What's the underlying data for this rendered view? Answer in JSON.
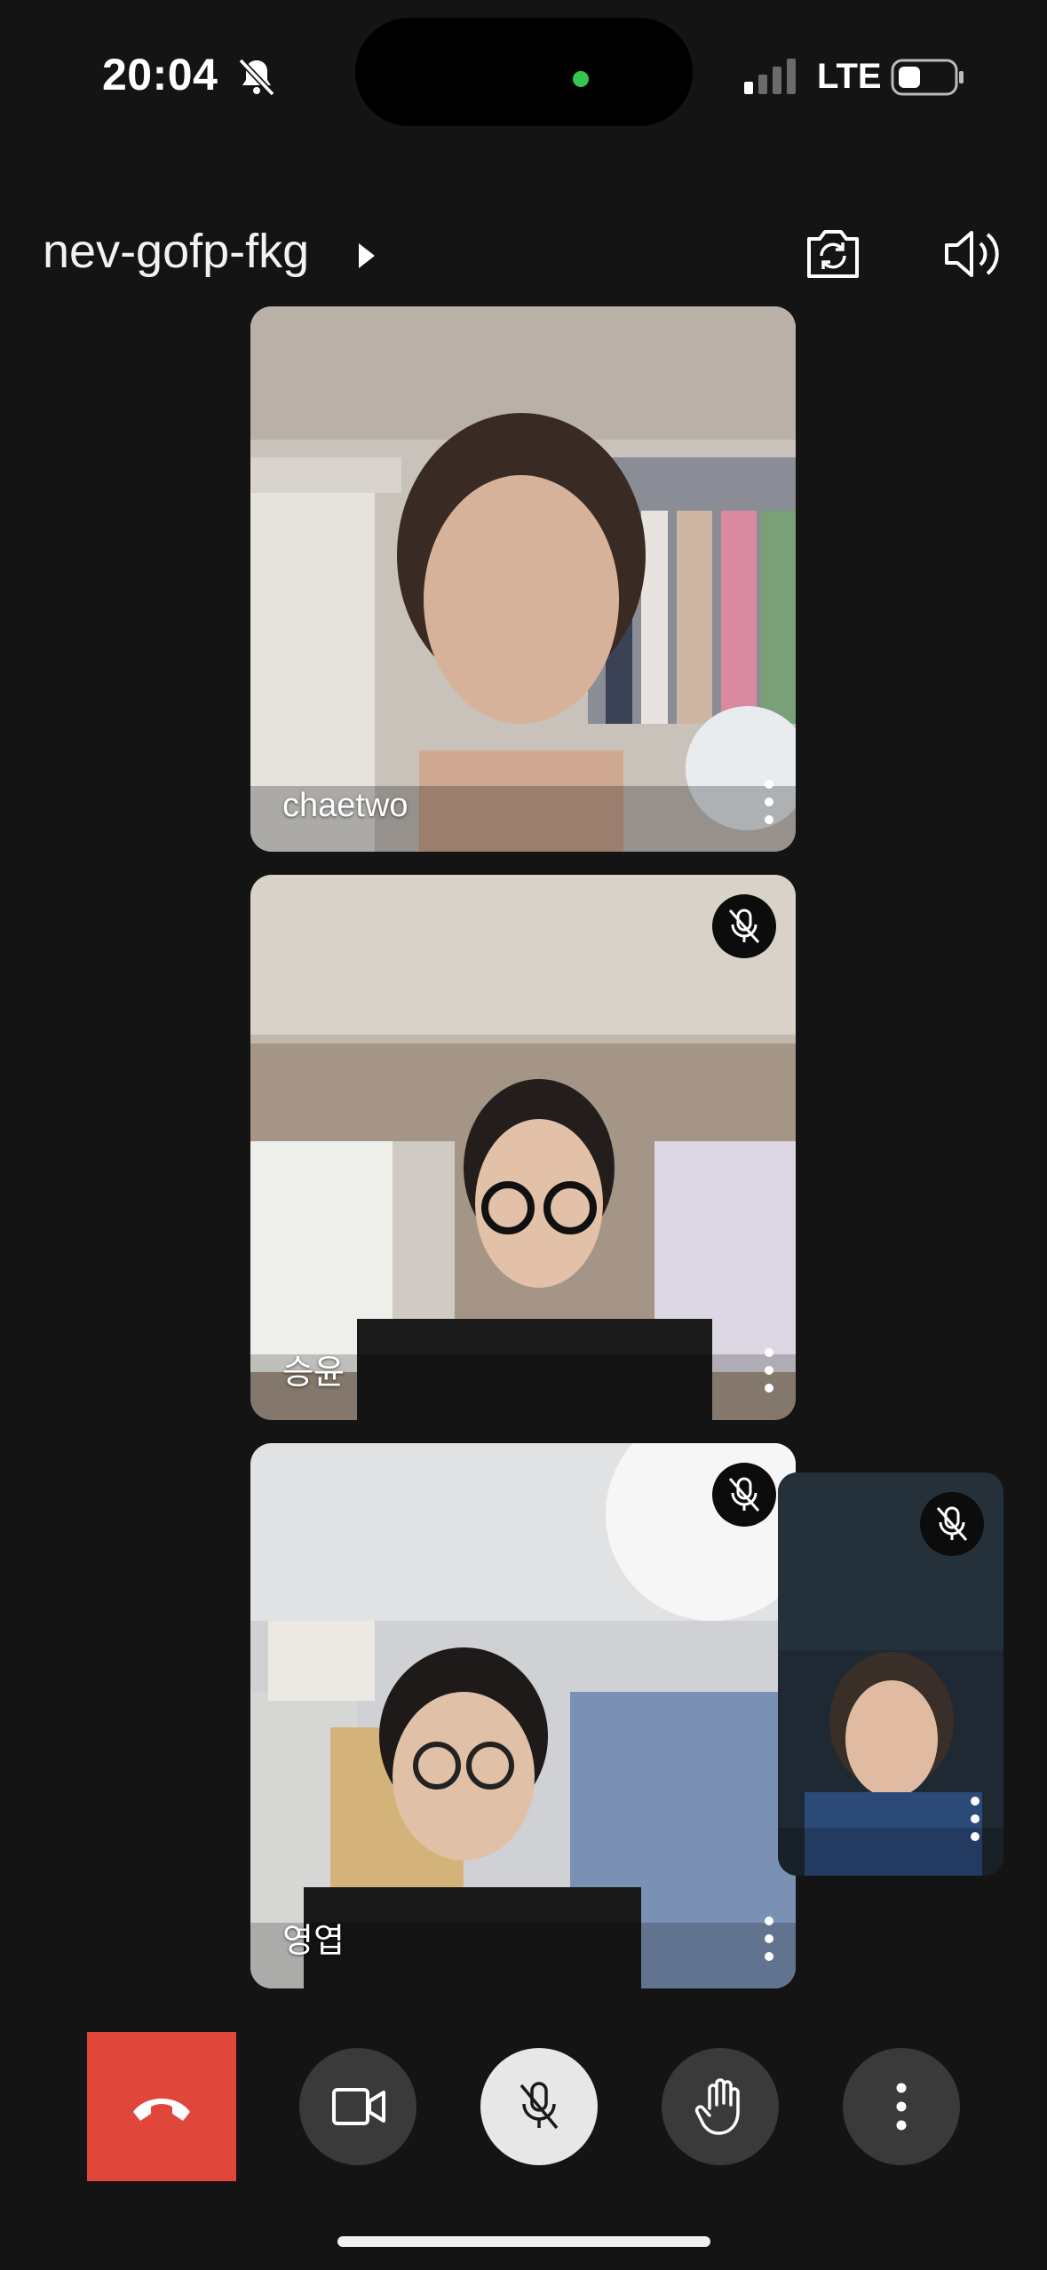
{
  "status_bar": {
    "time": "20:04",
    "network": "LTE",
    "icons": [
      "bell-slash-icon",
      "signal-icon",
      "battery-icon"
    ]
  },
  "header": {
    "meeting_code": "nev-gofp-fkg",
    "icons": [
      "caret-right-icon",
      "switch-camera-icon",
      "speaker-icon"
    ]
  },
  "participants": [
    {
      "name": "chaetwo",
      "muted": false
    },
    {
      "name": "승윤",
      "muted": true
    },
    {
      "name": "영엽",
      "muted": true
    }
  ],
  "self_view": {
    "muted": true
  },
  "controls": {
    "items": [
      "end-call",
      "camera",
      "microphone-muted",
      "raise-hand",
      "more-options"
    ]
  },
  "colors": {
    "background": "#141414",
    "end_call": "#e0463a",
    "control_dark": "#3a3a3a",
    "control_active": "#e7e7e7",
    "camera_dot": "#32c84f"
  }
}
